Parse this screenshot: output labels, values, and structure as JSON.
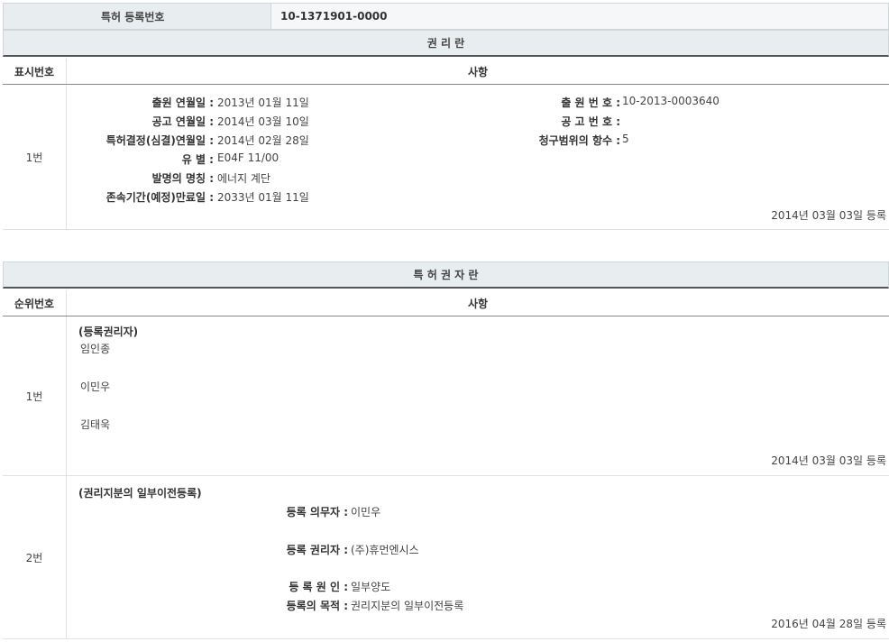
{
  "top": {
    "label": "특허 등록번호",
    "value": "10-1371901-0000"
  },
  "rights_section": {
    "title": "권 리 란",
    "col_num": "표시번호",
    "col_content": "사항",
    "row": {
      "number": "1번",
      "left_fields": [
        {
          "label": "출원 연월일 :",
          "value": "2013년 01월 11일"
        },
        {
          "label": "공고 연월일 :",
          "value": "2014년 03월 10일"
        },
        {
          "label": "특허결정(심결)연월일 :",
          "value": "2014년 02월 28일"
        },
        {
          "label": "유 별 :",
          "value": "E04F 11/00"
        },
        {
          "label": "발명의 명칭 :",
          "value": "에너지 계단"
        },
        {
          "label": "존속기간(예정)만료일 :",
          "value": "2033년 01월 11일"
        }
      ],
      "right_fields": [
        {
          "label": "출 원 번 호 :",
          "value": "10-2013-0003640"
        },
        {
          "label": "공 고 번 호 :",
          "value": ""
        },
        {
          "label": "청구범위의 항수 :",
          "value": "5"
        }
      ],
      "reg_date": "2014년 03월 03일 등록"
    }
  },
  "holders_section": {
    "title": "특 허 권 자 란",
    "col_num": "순위번호",
    "col_content": "사항",
    "rows": [
      {
        "number": "1번",
        "heading": "(등록권리자)",
        "names": [
          "임인종",
          "이민우",
          "김태욱"
        ],
        "reg_date": "2014년 03월 03일 등록"
      },
      {
        "number": "2번",
        "heading": "(권리지분의 일부이전등록)",
        "fields": [
          {
            "label": "등록 의무자 :",
            "value": "이민우"
          },
          {
            "label": "등록 권리자 :",
            "value": "(주)휴먼엔시스"
          },
          {
            "label": "등 록 원 인 :",
            "value": "일부양도"
          },
          {
            "label": "등록의 목적 :",
            "value": "권리지분의 일부이전등록"
          }
        ],
        "reg_date": "2016년 04월 28일 등록"
      }
    ]
  }
}
